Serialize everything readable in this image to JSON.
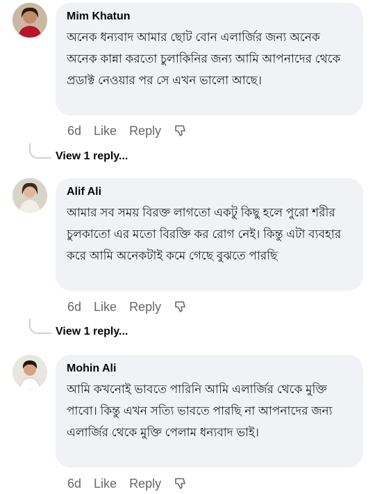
{
  "comments": [
    {
      "author": "Mim Khatun",
      "text": "অনেক ধন্যবাদ আমার ছোট বোন এলার্জির জন্য অনেক অনেক কান্না করতো চুলাকিনির জন্য আমি আপনাদের থেকে প্রডাক্ট নেওয়ার পর সে এখন ভালো আছে।",
      "time": "6d",
      "like": "Like",
      "reply": "Reply",
      "view_replies": "View 1 reply..."
    },
    {
      "author": "Alif Ali",
      "text": "আমার সব সময় বিরক্ত লাগতো একটু কিছু হলে পুরো শরীর চুলকাতো এর মতো বিরক্তি কর রোগ নেই। কিন্তু এটা ব্যবহার করে আমি অনেকটাই কমে গেছে বুঝতে পারছি",
      "time": "6d",
      "like": "Like",
      "reply": "Reply",
      "view_replies": "View 1 reply..."
    },
    {
      "author": "Mohin Ali",
      "text": "আমি কখনোই ভাবতে পারিনি আমি এলার্জির থেকে মুক্তি পাবো। কিন্তু এখন সত্যি ভাবতে পারছি না আপনাদের জন্য এলার্জির থেকে মুক্তি পেলাম ধন্যবাদ ভাই।",
      "time": "6d",
      "like": "Like",
      "reply": "Reply"
    }
  ],
  "icons": {
    "dislike": "thumbs-down-outline-icon",
    "avatar": "profile-photo"
  },
  "colors": {
    "bubble": "#f0f2f5",
    "meta": "#65676b",
    "text": "#050505"
  }
}
